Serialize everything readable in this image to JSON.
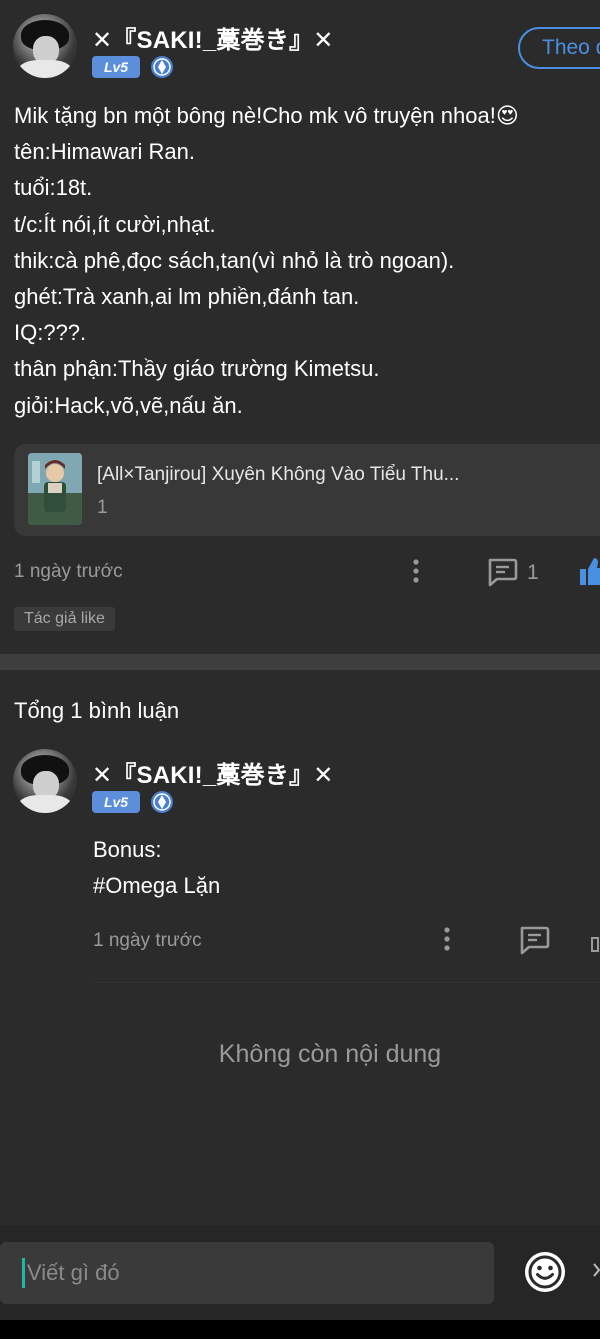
{
  "post": {
    "username": "✕『SAKI!_藁巻き』✕",
    "level": "Lv5",
    "follow_label": "Theo d",
    "lines": [
      "Mik tặng bn một bông nè!Cho mk vô truyện nhoa!😍",
      "tên:Himawari Ran.",
      "tuổi:18t.",
      "t/c:Ít nói,ít cười,nhạt.",
      "thik:cà phê,đọc sách,tan(vì nhỏ là trò ngoan).",
      "ghét:Trà xanh,ai lm phiền,đánh tan.",
      "IQ:???.",
      "thân phận:Thầy giáo trường Kimetsu.",
      "giỏi:Hack,võ,vẽ,nấu ăn."
    ],
    "book": {
      "title": "[All×Tanjirou] Xuyên Không Vào Tiểu Thu...",
      "count": "1"
    },
    "time": "1 ngày trước",
    "comment_count": "1",
    "author_like": "Tác giả like"
  },
  "comments": {
    "total_label": "Tổng 1 bình luận",
    "items": [
      {
        "username": "✕『SAKI!_藁巻き』✕",
        "level": "Lv5",
        "lines": [
          "Bonus:",
          "#Omega Lặn"
        ],
        "time": "1 ngày trước"
      }
    ],
    "no_more": "Không còn nội dung"
  },
  "composer": {
    "placeholder": "Viết gì đó"
  },
  "icons": {
    "more": "more-vertical-icon",
    "comment": "comment-icon",
    "like": "thumbs-up-icon",
    "emoji": "emoji-icon",
    "rank": "shield-badge-icon"
  },
  "colors": {
    "background": "#2b2b2b",
    "accent_blue": "#4a90e2",
    "level_badge": "#5b8fdc",
    "caret": "#1fb8a0"
  }
}
